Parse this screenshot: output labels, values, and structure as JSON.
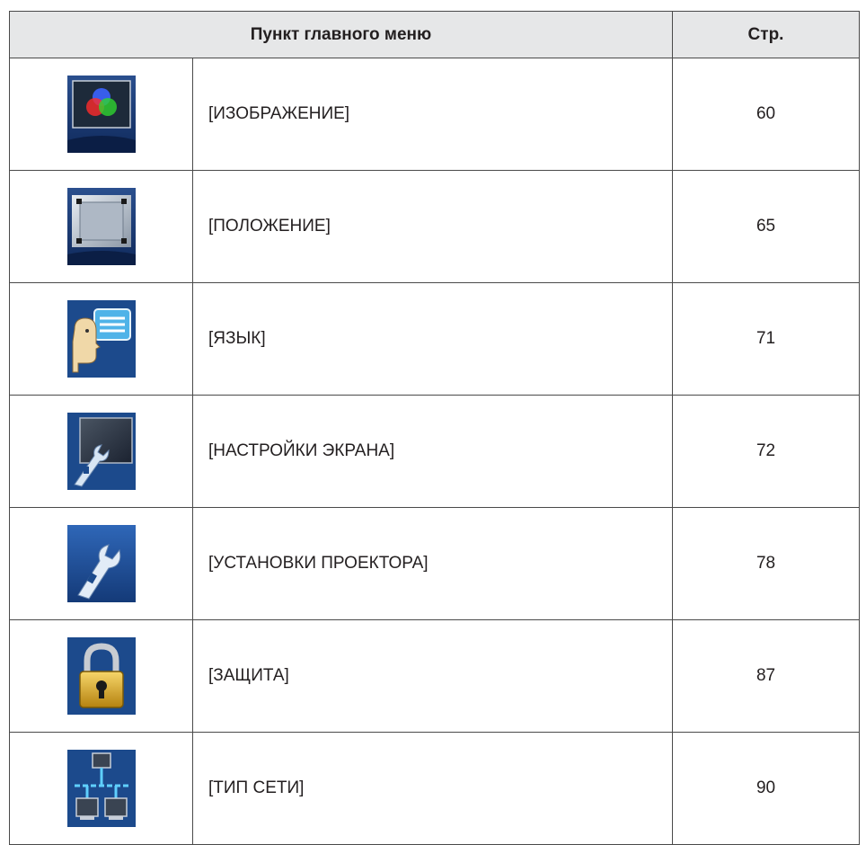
{
  "table": {
    "header": {
      "item_label": "Пункт главного меню",
      "page_label": "Стр."
    },
    "rows": [
      {
        "icon": "picture-icon",
        "name": "[ИЗОБРАЖЕНИЕ]",
        "page": "60"
      },
      {
        "icon": "position-icon",
        "name": "[ПОЛОЖЕНИЕ]",
        "page": "65"
      },
      {
        "icon": "language-icon",
        "name": "[ЯЗЫК]",
        "page": "71"
      },
      {
        "icon": "display-settings-icon",
        "name": "[НАСТРОЙКИ ЭКРАНА]",
        "page": "72"
      },
      {
        "icon": "projector-setup-icon",
        "name": "[УСТАНОВКИ ПРОЕКТОРА]",
        "page": "78"
      },
      {
        "icon": "security-lock-icon",
        "name": "[ЗАЩИТА]",
        "page": "87"
      },
      {
        "icon": "network-icon",
        "name": "[ТИП СЕТИ]",
        "page": "90"
      }
    ]
  }
}
